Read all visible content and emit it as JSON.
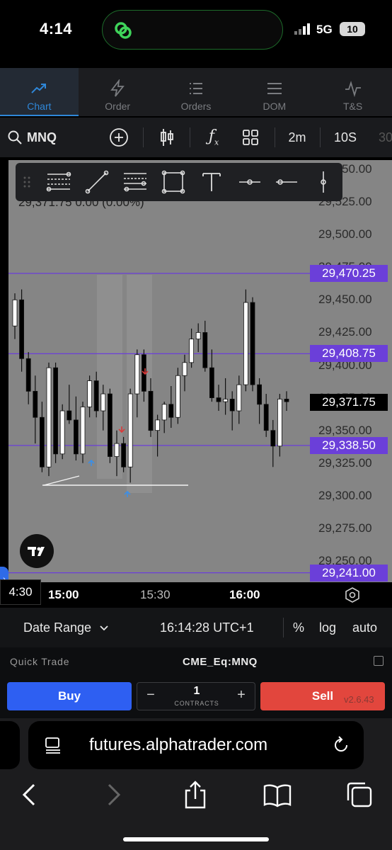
{
  "status_bar": {
    "time": "4:14",
    "network": "5G",
    "battery": "10"
  },
  "nav_tabs": [
    {
      "label": "Chart",
      "icon": "trend-icon",
      "active": true
    },
    {
      "label": "Order",
      "icon": "lightning-icon",
      "active": false
    },
    {
      "label": "Orders",
      "icon": "list-icon",
      "active": false
    },
    {
      "label": "DOM",
      "icon": "menu-icon",
      "active": false
    },
    {
      "label": "T&S",
      "icon": "pulse-icon",
      "active": false
    }
  ],
  "toolbar": {
    "symbol": "MNQ",
    "interval": "2m",
    "interval2": "10S",
    "interval3": "30"
  },
  "chart": {
    "ohlc_text": "29,371.75 0.00 (0.00%)",
    "price_axis": [
      "29,550.00",
      "29,525.00",
      "29,500.00",
      "29,475.00",
      "29,450.00",
      "29,425.00",
      "29,400.00",
      "29,375.00",
      "29,350.00",
      "29,325.00",
      "29,300.00",
      "29,275.00",
      "29,250.00"
    ],
    "price_tags": [
      {
        "label": "29,470.25",
        "color": "#6b3fd9"
      },
      {
        "label": "29,408.75",
        "color": "#6b3fd9"
      },
      {
        "label": "29,371.75",
        "color": "#000000"
      },
      {
        "label": "29,338.50",
        "color": "#6b3fd9"
      },
      {
        "label": "29,241.00",
        "color": "#6b3fd9"
      }
    ],
    "time_axis": [
      "15:00",
      "15:30",
      "16:00"
    ],
    "time_cursor": "4:30"
  },
  "chart_data": {
    "type": "candlestick",
    "title": "",
    "xlabel": "",
    "ylabel": "",
    "ylim": [
      29241,
      29560
    ],
    "horizontal_levels": [
      29470.25,
      29408.75,
      29338.5,
      29241.0
    ],
    "last_price": 29371.75,
    "x_ticks": [
      "15:00",
      "15:30",
      "16:00"
    ],
    "candles": [
      {
        "o": 29430,
        "h": 29455,
        "l": 29420,
        "c": 29450
      },
      {
        "o": 29450,
        "h": 29458,
        "l": 29395,
        "c": 29405
      },
      {
        "o": 29405,
        "h": 29410,
        "l": 29370,
        "c": 29380
      },
      {
        "o": 29380,
        "h": 29392,
        "l": 29340,
        "c": 29360
      },
      {
        "o": 29360,
        "h": 29372,
        "l": 29318,
        "c": 29322
      },
      {
        "o": 29322,
        "h": 29402,
        "l": 29315,
        "c": 29398
      },
      {
        "o": 29398,
        "h": 29402,
        "l": 29325,
        "c": 29332
      },
      {
        "o": 29332,
        "h": 29370,
        "l": 29328,
        "c": 29365
      },
      {
        "o": 29365,
        "h": 29385,
        "l": 29355,
        "c": 29358
      },
      {
        "o": 29358,
        "h": 29376,
        "l": 29327,
        "c": 29332
      },
      {
        "o": 29332,
        "h": 29372,
        "l": 29325,
        "c": 29368
      },
      {
        "o": 29368,
        "h": 29392,
        "l": 29360,
        "c": 29388
      },
      {
        "o": 29388,
        "h": 29395,
        "l": 29360,
        "c": 29365
      },
      {
        "o": 29365,
        "h": 29385,
        "l": 29350,
        "c": 29378
      },
      {
        "o": 29378,
        "h": 29382,
        "l": 29325,
        "c": 29330
      },
      {
        "o": 29330,
        "h": 29350,
        "l": 29315,
        "c": 29340
      },
      {
        "o": 29340,
        "h": 29345,
        "l": 29318,
        "c": 29322
      },
      {
        "o": 29322,
        "h": 29382,
        "l": 29310,
        "c": 29378
      },
      {
        "o": 29378,
        "h": 29412,
        "l": 29360,
        "c": 29408
      },
      {
        "o": 29408,
        "h": 29412,
        "l": 29372,
        "c": 29380
      },
      {
        "o": 29380,
        "h": 29390,
        "l": 29345,
        "c": 29350
      },
      {
        "o": 29350,
        "h": 29362,
        "l": 29330,
        "c": 29358
      },
      {
        "o": 29358,
        "h": 29372,
        "l": 29348,
        "c": 29370
      },
      {
        "o": 29370,
        "h": 29384,
        "l": 29352,
        "c": 29360
      },
      {
        "o": 29360,
        "h": 29398,
        "l": 29355,
        "c": 29392
      },
      {
        "o": 29392,
        "h": 29408,
        "l": 29380,
        "c": 29402
      },
      {
        "o": 29402,
        "h": 29428,
        "l": 29398,
        "c": 29420
      },
      {
        "o": 29420,
        "h": 29432,
        "l": 29410,
        "c": 29425
      },
      {
        "o": 29425,
        "h": 29434,
        "l": 29395,
        "c": 29398
      },
      {
        "o": 29398,
        "h": 29412,
        "l": 29372,
        "c": 29375
      },
      {
        "o": 29375,
        "h": 29385,
        "l": 29365,
        "c": 29372
      },
      {
        "o": 29372,
        "h": 29390,
        "l": 29362,
        "c": 29374
      },
      {
        "o": 29374,
        "h": 29380,
        "l": 29350,
        "c": 29365
      },
      {
        "o": 29365,
        "h": 29392,
        "l": 29355,
        "c": 29385
      },
      {
        "o": 29385,
        "h": 29458,
        "l": 29380,
        "c": 29448
      },
      {
        "o": 29448,
        "h": 29452,
        "l": 29380,
        "c": 29385
      },
      {
        "o": 29385,
        "h": 29390,
        "l": 29355,
        "c": 29370
      },
      {
        "o": 29370,
        "h": 29378,
        "l": 29345,
        "c": 29350
      },
      {
        "o": 29350,
        "h": 29358,
        "l": 29322,
        "c": 29338
      },
      {
        "o": 29338,
        "h": 29378,
        "l": 29330,
        "c": 29374
      },
      {
        "o": 29374,
        "h": 29380,
        "l": 29365,
        "c": 29372
      }
    ]
  },
  "info_bar": {
    "date_range": "Date Range",
    "clock": "16:14:28 UTC+1",
    "percent": "%",
    "log": "log",
    "auto": "auto"
  },
  "quick_trade": {
    "title": "Quick Trade",
    "instrument": "CME_Eq:MNQ",
    "buy": "Buy",
    "sell": "Sell",
    "quantity": "1",
    "quantity_label": "CONTRACTS",
    "minus": "−",
    "plus": "+",
    "version": "v2.6.43"
  },
  "browser": {
    "url": "futures.alphatrader.com"
  }
}
